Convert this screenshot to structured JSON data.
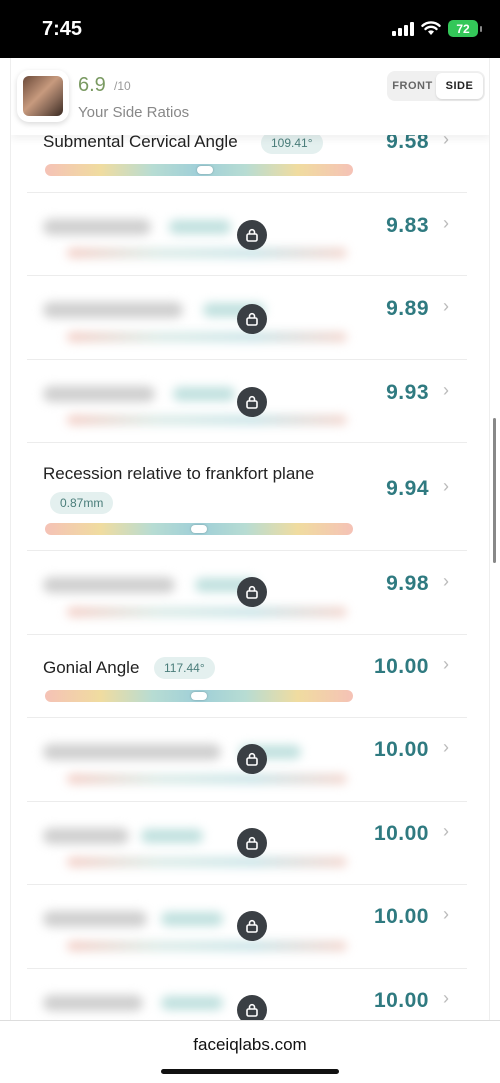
{
  "status_bar": {
    "time": "7:45",
    "battery": "72"
  },
  "header": {
    "score": "6.9",
    "score_max": "/10",
    "subtitle": "Your Side Ratios",
    "tab_front": "FRONT",
    "tab_side": "SIDE",
    "active_tab": "SIDE"
  },
  "rows": [
    {
      "name": "Submental Cervical Angle",
      "value": "109.41°",
      "score": "9.58",
      "locked": false,
      "slider_position": 0.52
    },
    {
      "score": "9.83",
      "locked": true
    },
    {
      "score": "9.89",
      "locked": true
    },
    {
      "score": "9.93",
      "locked": true
    },
    {
      "name": "Recession relative to frankfort plane",
      "value": "0.87mm",
      "score": "9.94",
      "locked": false,
      "slider_position": 0.5
    },
    {
      "score": "9.98",
      "locked": true
    },
    {
      "name": "Gonial Angle",
      "value": "117.44°",
      "score": "10.00",
      "locked": false,
      "slider_position": 0.5
    },
    {
      "score": "10.00",
      "locked": true
    },
    {
      "score": "10.00",
      "locked": true
    },
    {
      "score": "10.00",
      "locked": true
    },
    {
      "score": "10.00",
      "locked": true
    }
  ],
  "icons": {
    "lock": "lock-icon",
    "chevron": "chevron-right-icon"
  },
  "browser": {
    "url": "faceiqlabs.com"
  }
}
